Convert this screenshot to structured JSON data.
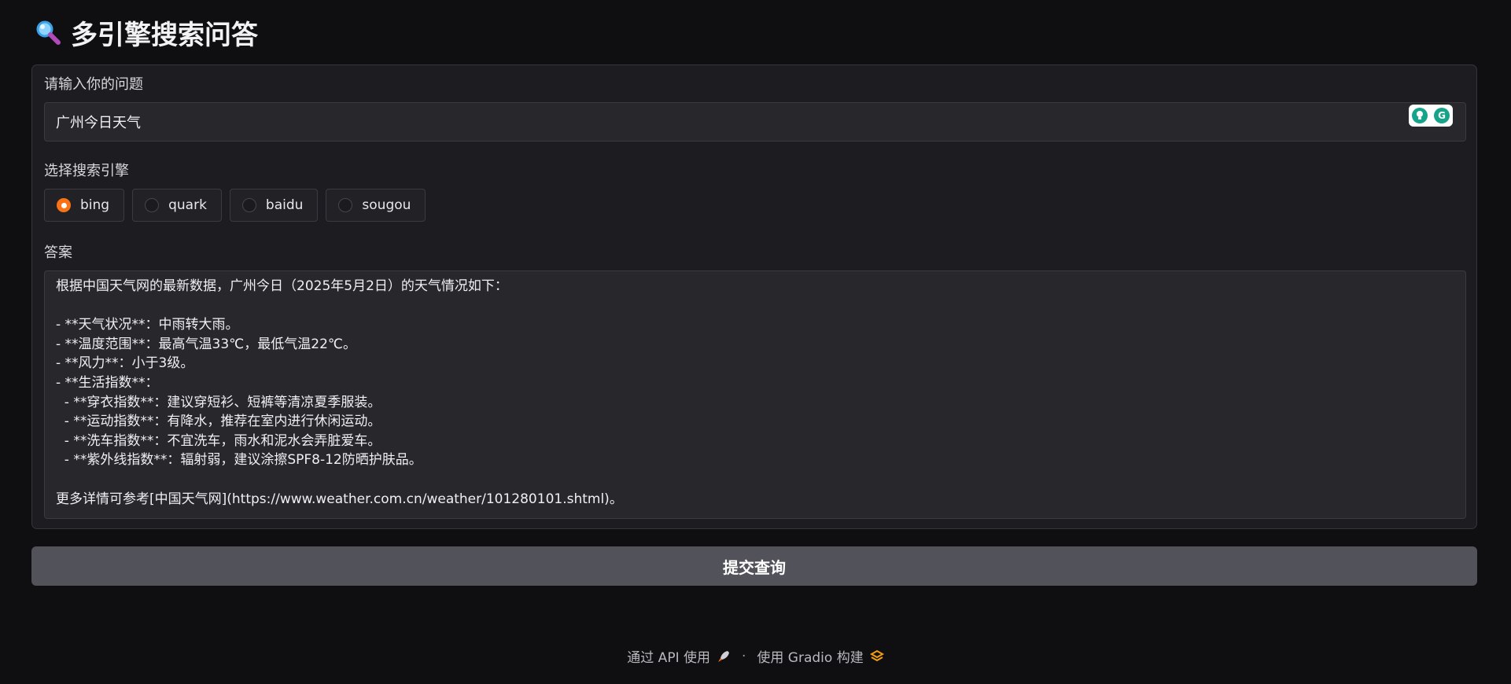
{
  "header": {
    "title": "多引擎搜索问答",
    "icon": "magnifier-icon"
  },
  "question": {
    "label": "请输入你的问题",
    "value": "广州今日天气"
  },
  "engine": {
    "label": "选择搜索引擎",
    "options": [
      "bing",
      "quark",
      "baidu",
      "sougou"
    ],
    "selected": "bing"
  },
  "answer": {
    "label": "答案",
    "value": "根据中国天气网的最新数据，广州今日（2025年5月2日）的天气情况如下：\n\n- **天气状况**：中雨转大雨。\n- **温度范围**：最高气温33℃，最低气温22℃。\n- **风力**：小于3级。\n- **生活指数**：\n  - **穿衣指数**：建议穿短衫、短裤等清凉夏季服装。\n  - **运动指数**：有降水，推荐在室内进行休闲运动。\n  - **洗车指数**：不宜洗车，雨水和泥水会弄脏爱车。\n  - **紫外线指数**：辐射弱，建议涂擦SPF8-12防晒护肤品。\n\n更多详情可参考[中国天气网](https://www.weather.com.cn/weather/101280101.shtml)。"
  },
  "submit": {
    "label": "提交查询"
  },
  "footer": {
    "api_text": "通过 API 使用",
    "separator": "·",
    "built_text": "使用 Gradio 构建"
  },
  "colors": {
    "accent": "#f97316",
    "background": "#0f0f11",
    "panel": "#1d1d21",
    "button": "#52525b",
    "grammarly": "#15a38a"
  }
}
